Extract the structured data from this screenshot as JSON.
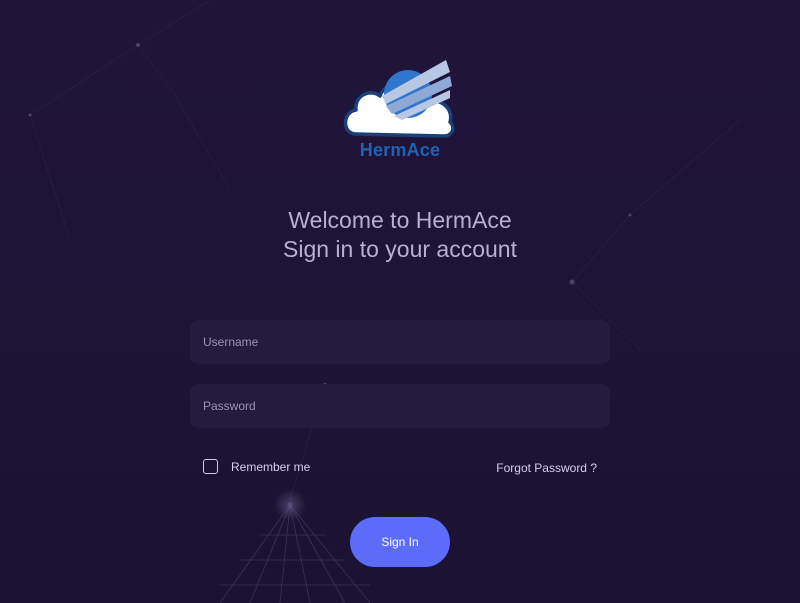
{
  "brand": {
    "name": "HermAce",
    "colors": {
      "cloud_fill": "#ffffff",
      "cloud_stroke": "#1a3f7a",
      "globe": "#2f76cc",
      "stripe": "#b9c7e6",
      "text": "#1e63b5"
    }
  },
  "heading": {
    "line1": "Welcome to HermAce",
    "line2": "Sign in to your account"
  },
  "form": {
    "username_placeholder": "Username",
    "password_placeholder": "Password",
    "remember_label": "Remember me",
    "forgot_label": "Forgot Password ?",
    "signin_label": "Sign In"
  },
  "colors": {
    "background": "#1b1333",
    "input_bg": "#241b3e",
    "heading_text": "#b6b0d2",
    "accent_button": "#5c6cf8"
  }
}
